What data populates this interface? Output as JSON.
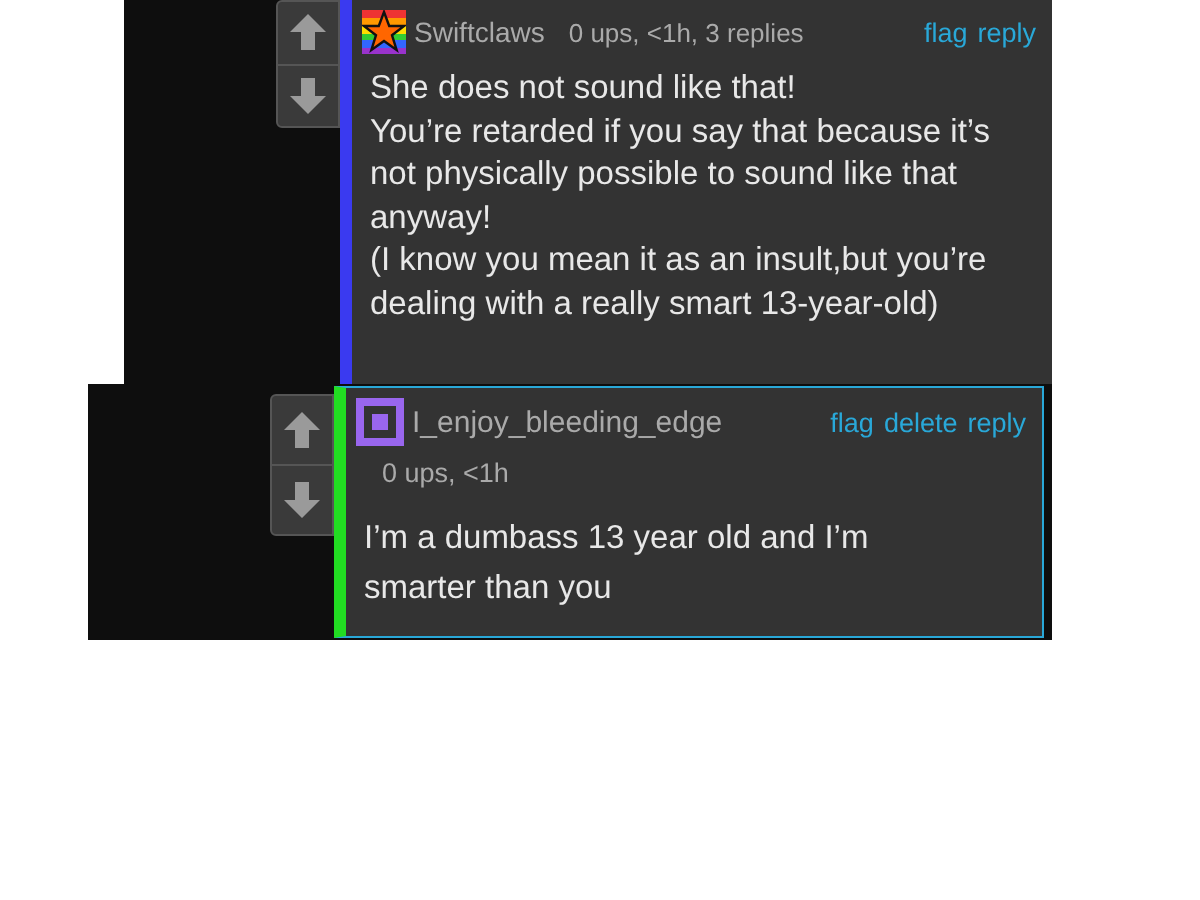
{
  "comments": [
    {
      "kind": "top",
      "avatar": {
        "kind": "star"
      },
      "color": "#3a3af0",
      "username": "Swiftclaws",
      "meta": "0 ups, <1h, 3 replies",
      "actions": [
        "flag",
        "reply"
      ],
      "body": "She does not sound like that!\nYou’re retarded if you say that because it’s not physically possible to sound like that anyway!\n(I know you mean it as an insult,but you’re dealing with a really smart 13-year-old)"
    },
    {
      "kind": "reply",
      "avatar": {
        "kind": "square"
      },
      "color": "#22dd22",
      "username": "I_enjoy_bleeding_edge",
      "meta": "0 ups, <1h",
      "actions": [
        "flag",
        "delete",
        "reply"
      ],
      "body": "I’m a dumbass 13 year old and I’m smarter than you"
    }
  ]
}
